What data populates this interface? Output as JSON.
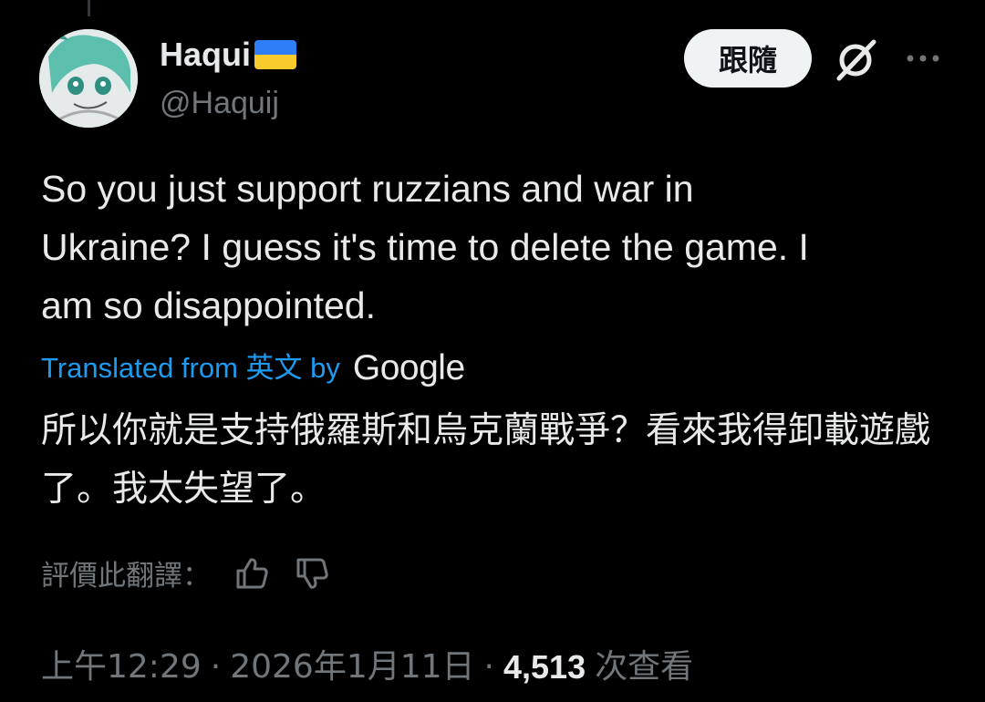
{
  "user": {
    "name": "Haqui",
    "handle": "@Haquij",
    "flag_colors": [
      "#2f7ef7",
      "#f9cb2c"
    ]
  },
  "header": {
    "follow_label": "跟隨",
    "grok_icon": "grok-slash-icon",
    "more_icon": "more-dots-icon"
  },
  "tweet": {
    "text": "So you just support ruzzians and war in\nUkraine? I guess it's time to delete the game. I\nam so disappointed.",
    "translated_prefix": "Translated from 英文 by",
    "translator": "Google",
    "translated_text": "所以你就是支持俄羅斯和烏克蘭戰爭？看來我得卸載遊戲了。我太失望了。"
  },
  "rating": {
    "label": "評價此翻譯：",
    "thumbs_up_icon": "thumbs-up-icon",
    "thumbs_down_icon": "thumbs-down-icon"
  },
  "meta": {
    "time": "上午12:29",
    "dot": "·",
    "date": "2026年1月11日",
    "views_count": "4,513",
    "views_label": "次查看"
  },
  "colors": {
    "background": "#000000",
    "text": "#e7e9ea",
    "secondary": "#71767b",
    "link": "#1d9bf0",
    "follow_bg": "#eff3f4"
  }
}
